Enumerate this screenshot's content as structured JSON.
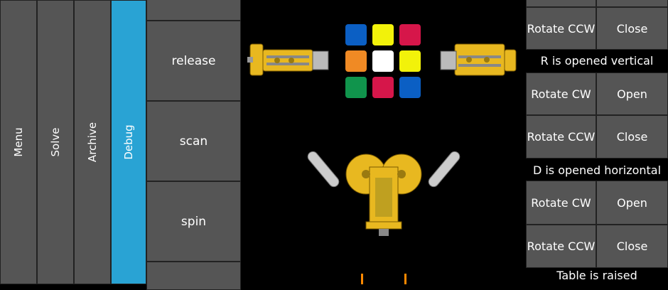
{
  "tabs": [
    {
      "label": "Menu"
    },
    {
      "label": "Solve"
    },
    {
      "label": "Archive"
    },
    {
      "label": "Debug"
    }
  ],
  "commands": [
    {
      "label": ""
    },
    {
      "label": "release"
    },
    {
      "label": "scan"
    },
    {
      "label": "spin"
    },
    {
      "label": ""
    }
  ],
  "controls": {
    "top": {
      "left_label": "",
      "right_label": ""
    },
    "r_group": {
      "ccw_label": "Rotate CCW",
      "close_label": "Close",
      "status": "R is opened vertical"
    },
    "d_group": {
      "cw_label": "Rotate CW",
      "open_label": "Open",
      "ccw_label": "Rotate CCW",
      "close_label": "Close",
      "status": "D is opened horizontal"
    },
    "table_group": {
      "cw_label": "Rotate CW",
      "open_label": "Open",
      "ccw_label": "Rotate CCW",
      "close_label": "Close",
      "status": "Table is raised"
    }
  },
  "cube_face_colors": [
    "#0b5fc4",
    "#f2f20a",
    "#d6164a",
    "#f08a24",
    "#ffffff",
    "#f2f20a",
    "#10944c",
    "#d6164a",
    "#0b5fc4"
  ],
  "colors": {
    "active_tab": "#29a3d4",
    "button_bg": "#555555",
    "robot_gold": "#e8b820"
  }
}
